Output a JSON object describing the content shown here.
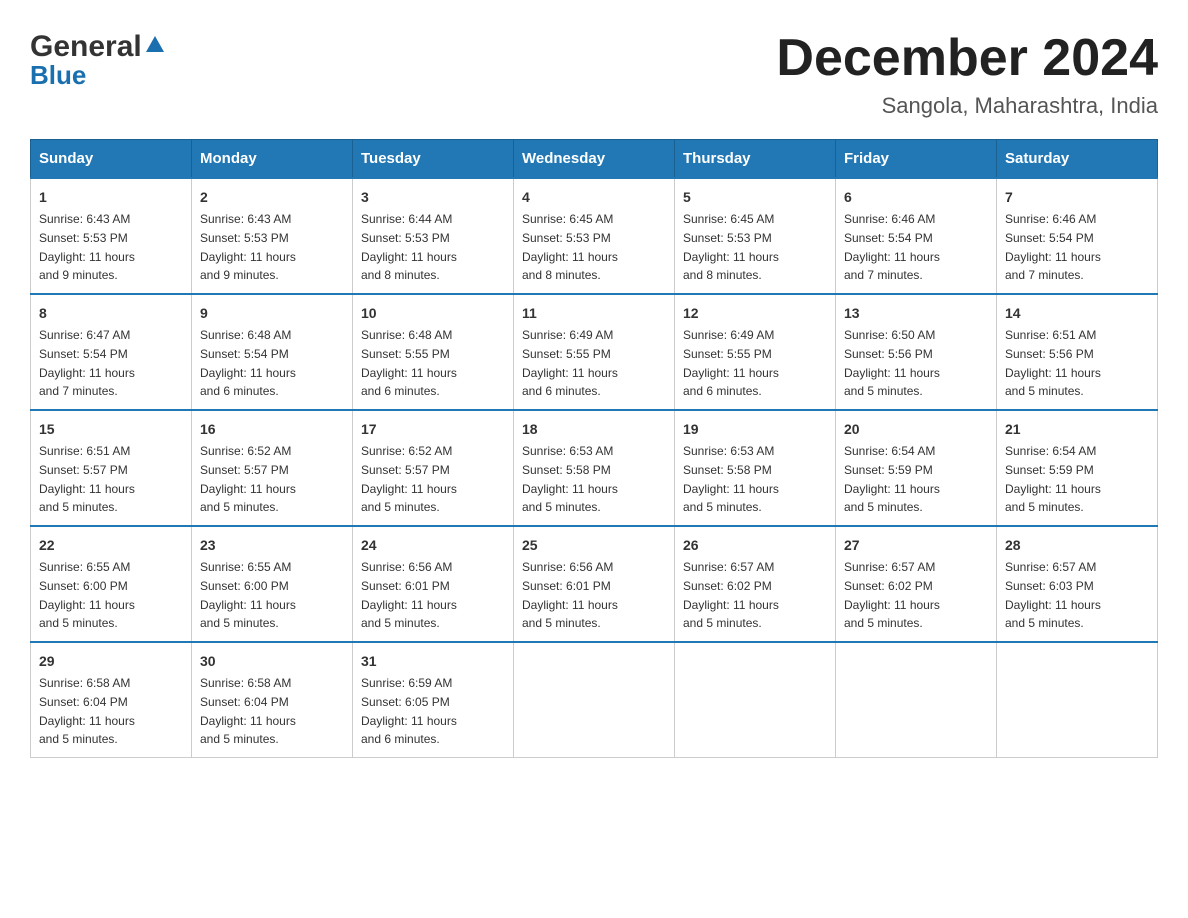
{
  "logo": {
    "general": "General",
    "blue": "Blue"
  },
  "header": {
    "month_title": "December 2024",
    "location": "Sangola, Maharashtra, India"
  },
  "days_of_week": [
    "Sunday",
    "Monday",
    "Tuesday",
    "Wednesday",
    "Thursday",
    "Friday",
    "Saturday"
  ],
  "weeks": [
    [
      {
        "day": "1",
        "sunrise": "6:43 AM",
        "sunset": "5:53 PM",
        "daylight": "11 hours and 9 minutes."
      },
      {
        "day": "2",
        "sunrise": "6:43 AM",
        "sunset": "5:53 PM",
        "daylight": "11 hours and 9 minutes."
      },
      {
        "day": "3",
        "sunrise": "6:44 AM",
        "sunset": "5:53 PM",
        "daylight": "11 hours and 8 minutes."
      },
      {
        "day": "4",
        "sunrise": "6:45 AM",
        "sunset": "5:53 PM",
        "daylight": "11 hours and 8 minutes."
      },
      {
        "day": "5",
        "sunrise": "6:45 AM",
        "sunset": "5:53 PM",
        "daylight": "11 hours and 8 minutes."
      },
      {
        "day": "6",
        "sunrise": "6:46 AM",
        "sunset": "5:54 PM",
        "daylight": "11 hours and 7 minutes."
      },
      {
        "day": "7",
        "sunrise": "6:46 AM",
        "sunset": "5:54 PM",
        "daylight": "11 hours and 7 minutes."
      }
    ],
    [
      {
        "day": "8",
        "sunrise": "6:47 AM",
        "sunset": "5:54 PM",
        "daylight": "11 hours and 7 minutes."
      },
      {
        "day": "9",
        "sunrise": "6:48 AM",
        "sunset": "5:54 PM",
        "daylight": "11 hours and 6 minutes."
      },
      {
        "day": "10",
        "sunrise": "6:48 AM",
        "sunset": "5:55 PM",
        "daylight": "11 hours and 6 minutes."
      },
      {
        "day": "11",
        "sunrise": "6:49 AM",
        "sunset": "5:55 PM",
        "daylight": "11 hours and 6 minutes."
      },
      {
        "day": "12",
        "sunrise": "6:49 AM",
        "sunset": "5:55 PM",
        "daylight": "11 hours and 6 minutes."
      },
      {
        "day": "13",
        "sunrise": "6:50 AM",
        "sunset": "5:56 PM",
        "daylight": "11 hours and 5 minutes."
      },
      {
        "day": "14",
        "sunrise": "6:51 AM",
        "sunset": "5:56 PM",
        "daylight": "11 hours and 5 minutes."
      }
    ],
    [
      {
        "day": "15",
        "sunrise": "6:51 AM",
        "sunset": "5:57 PM",
        "daylight": "11 hours and 5 minutes."
      },
      {
        "day": "16",
        "sunrise": "6:52 AM",
        "sunset": "5:57 PM",
        "daylight": "11 hours and 5 minutes."
      },
      {
        "day": "17",
        "sunrise": "6:52 AM",
        "sunset": "5:57 PM",
        "daylight": "11 hours and 5 minutes."
      },
      {
        "day": "18",
        "sunrise": "6:53 AM",
        "sunset": "5:58 PM",
        "daylight": "11 hours and 5 minutes."
      },
      {
        "day": "19",
        "sunrise": "6:53 AM",
        "sunset": "5:58 PM",
        "daylight": "11 hours and 5 minutes."
      },
      {
        "day": "20",
        "sunrise": "6:54 AM",
        "sunset": "5:59 PM",
        "daylight": "11 hours and 5 minutes."
      },
      {
        "day": "21",
        "sunrise": "6:54 AM",
        "sunset": "5:59 PM",
        "daylight": "11 hours and 5 minutes."
      }
    ],
    [
      {
        "day": "22",
        "sunrise": "6:55 AM",
        "sunset": "6:00 PM",
        "daylight": "11 hours and 5 minutes."
      },
      {
        "day": "23",
        "sunrise": "6:55 AM",
        "sunset": "6:00 PM",
        "daylight": "11 hours and 5 minutes."
      },
      {
        "day": "24",
        "sunrise": "6:56 AM",
        "sunset": "6:01 PM",
        "daylight": "11 hours and 5 minutes."
      },
      {
        "day": "25",
        "sunrise": "6:56 AM",
        "sunset": "6:01 PM",
        "daylight": "11 hours and 5 minutes."
      },
      {
        "day": "26",
        "sunrise": "6:57 AM",
        "sunset": "6:02 PM",
        "daylight": "11 hours and 5 minutes."
      },
      {
        "day": "27",
        "sunrise": "6:57 AM",
        "sunset": "6:02 PM",
        "daylight": "11 hours and 5 minutes."
      },
      {
        "day": "28",
        "sunrise": "6:57 AM",
        "sunset": "6:03 PM",
        "daylight": "11 hours and 5 minutes."
      }
    ],
    [
      {
        "day": "29",
        "sunrise": "6:58 AM",
        "sunset": "6:04 PM",
        "daylight": "11 hours and 5 minutes."
      },
      {
        "day": "30",
        "sunrise": "6:58 AM",
        "sunset": "6:04 PM",
        "daylight": "11 hours and 5 minutes."
      },
      {
        "day": "31",
        "sunrise": "6:59 AM",
        "sunset": "6:05 PM",
        "daylight": "11 hours and 6 minutes."
      },
      null,
      null,
      null,
      null
    ]
  ],
  "labels": {
    "sunrise": "Sunrise:",
    "sunset": "Sunset:",
    "daylight": "Daylight:"
  }
}
